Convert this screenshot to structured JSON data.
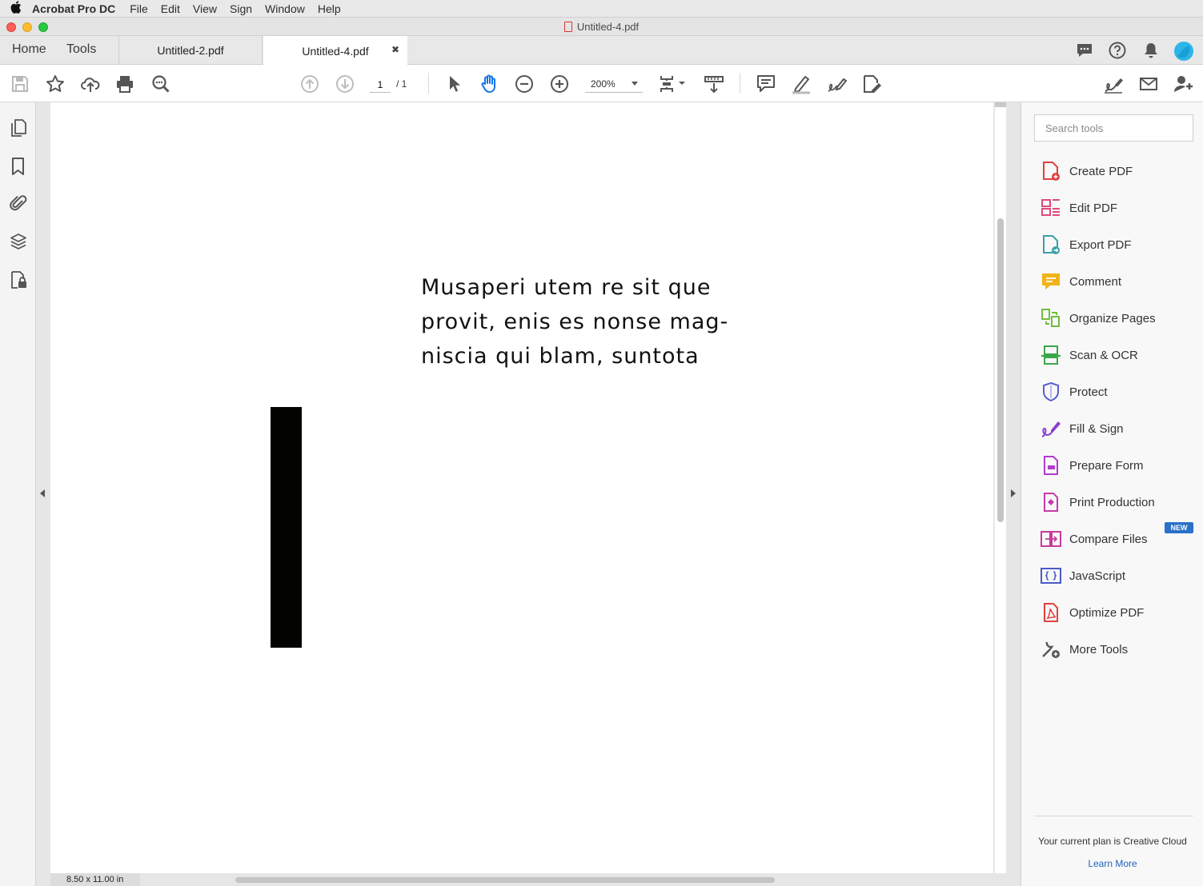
{
  "menubar": {
    "app_name": "Acrobat Pro DC",
    "items": [
      "File",
      "Edit",
      "View",
      "Sign",
      "Window",
      "Help"
    ]
  },
  "window": {
    "title": "Untitled-4.pdf"
  },
  "tabs": {
    "home": "Home",
    "tools": "Tools",
    "documents": [
      {
        "label": "Untitled-2.pdf",
        "active": false
      },
      {
        "label": "Untitled-4.pdf",
        "active": true
      }
    ],
    "close_glyph": "✖"
  },
  "toolbar": {
    "page_current": "1",
    "page_total": "/ 1",
    "zoom": "200%"
  },
  "document": {
    "lines": [
      "Musaperi utem re sit que",
      "provit, enis es nonse mag-",
      "niscia qui blam, suntota"
    ],
    "page_size": "8.50 x 11.00 in"
  },
  "right_panel": {
    "search_placeholder": "Search tools",
    "tools": [
      {
        "label": "Create PDF",
        "icon": "create-pdf-icon",
        "color": "#e0413e"
      },
      {
        "label": "Edit PDF",
        "icon": "edit-pdf-icon",
        "color": "#e04a7a"
      },
      {
        "label": "Export PDF",
        "icon": "export-pdf-icon",
        "color": "#3aa0a8"
      },
      {
        "label": "Comment",
        "icon": "comment-icon",
        "color": "#f0b31a"
      },
      {
        "label": "Organize Pages",
        "icon": "organize-pages-icon",
        "color": "#6fbf3c"
      },
      {
        "label": "Scan & OCR",
        "icon": "scan-ocr-icon",
        "color": "#3aa84a"
      },
      {
        "label": "Protect",
        "icon": "protect-icon",
        "color": "#5a5fd0"
      },
      {
        "label": "Fill & Sign",
        "icon": "fill-sign-icon",
        "color": "#8a3fd0"
      },
      {
        "label": "Prepare Form",
        "icon": "prepare-form-icon",
        "color": "#b23ad0"
      },
      {
        "label": "Print Production",
        "icon": "print-production-icon",
        "color": "#c83aa8"
      },
      {
        "label": "Compare Files",
        "icon": "compare-files-icon",
        "color": "#c83a9a"
      },
      {
        "label": "JavaScript",
        "icon": "javascript-icon",
        "color": "#4a5ac8"
      },
      {
        "label": "Optimize PDF",
        "icon": "optimize-pdf-icon",
        "color": "#e0413e"
      },
      {
        "label": "More Tools",
        "icon": "more-tools-icon",
        "color": "#555555"
      }
    ],
    "new_badge": "NEW",
    "plan_text": "Your current plan is Creative Cloud",
    "learn_more": "Learn More"
  },
  "colors": {
    "accent": "#2b71c9",
    "hand_tool_active": "#1473e6",
    "avatar": "#2bb5e8"
  }
}
